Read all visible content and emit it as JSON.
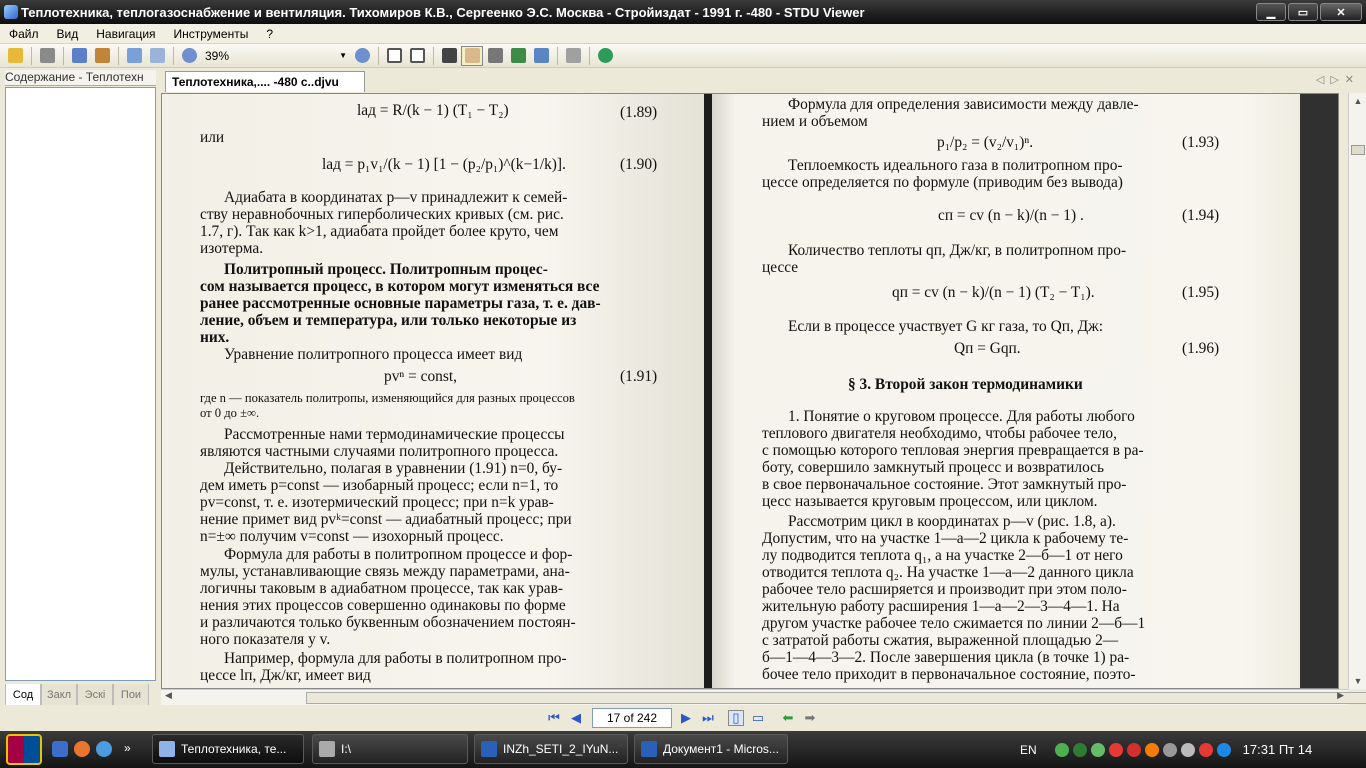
{
  "window": {
    "title": "Теплотехника, теплогазоснабжение и вентиляция. Тихомиров К.В., Сергеенко Э.С. Москва - Стройиздат - 1991 г. -480 - STDU Viewer",
    "min_label": "▁",
    "max_label": "▭",
    "close_label": "✕"
  },
  "menu": [
    "Файл",
    "Вид",
    "Навигация",
    "Инструменты",
    "?"
  ],
  "toolbar": {
    "zoom": "39%"
  },
  "left_panel": {
    "title": "Содержание - Теплотехн",
    "tabs": [
      "Сод",
      "Закл",
      "Эскі",
      "Пои"
    ]
  },
  "doc_tab": {
    "label": "Теплотехника,.... -480 с..djvu"
  },
  "page_left": {
    "eq189": "lад = R/(k − 1) (T₁ − T₂)",
    "eq189_no": "(1.89)",
    "ili": "или",
    "eq190": "lад = p₁v₁/(k − 1) [1 − (p₂/p₁)^(k−1/k)].",
    "eq190_no": "(1.90)",
    "p1": [
      "Адиабата в координатах p—v принадлежит к семей-",
      "ству неравнобочных гиперболических кривых (см. рис.",
      "1.7, г). Так как k>1, адиабата пройдет более круто, чем",
      "изотерма."
    ],
    "p2": [
      "Политропный процесс. Политропным процес-",
      "сом называется процесс, в котором могут изменяться все",
      "ранее рассмотренные основные параметры газа, т. е. дав-",
      "ление, объем и температура, или только некоторые из",
      "них."
    ],
    "p3": "Уравнение политропного процесса имеет вид",
    "eq191": "pvⁿ = const,",
    "eq191_no": "(1.91)",
    "note": [
      "где n — показатель политропы, изменяющийся для разных процессов",
      "от 0 до ±∞."
    ],
    "p4": [
      "Рассмотренные нами термодинамические процессы",
      "являются частными случаями политропного процесса."
    ],
    "p5": [
      "Действительно, полагая в уравнении (1.91) n=0, бу-",
      "дем иметь p=const — изобарный процесс; если n=1, то",
      "pv=const, т. е. изотермический процесс; при n=k урав-",
      "нение примет вид pvᵏ=const — адиабатный процесс; при",
      "n=±∞ получим v=const — изохорный процесс."
    ],
    "p6": [
      "Формула для работы в политропном процессе и фор-",
      "мулы, устанавливающие связь между параметрами, ана-",
      "логичны таковым в адиабатном процессе, так как урав-",
      "нения этих процессов совершенно одинаковы по форме",
      "и различаются только буквенным обозначением постоян-",
      "ного показателя у v."
    ],
    "p7": [
      "Например, формула для работы в политропном про-",
      "цессе lп, Дж/кг, имеет вид"
    ]
  },
  "page_right": {
    "p1": [
      "Формула для определения зависимости между давле-",
      "нием и объемом"
    ],
    "eq193": "p₁/p₂ = (v₂/v₁)ⁿ.",
    "eq193_no": "(1.93)",
    "p2": [
      "Теплоемкость идеального газа в политропном про-",
      "цессе определяется по формуле (приводим без вывода)"
    ],
    "eq194": "cп = cv (n − k)/(n − 1) .",
    "eq194_no": "(1.94)",
    "p3": [
      "Количество теплоты qп, Дж/кг, в политропном про-",
      "цессе"
    ],
    "eq195": "qп = cv (n − k)/(n − 1) (T₂ − T₁).",
    "eq195_no": "(1.95)",
    "p4": "Если в процессе участвует G кг газа, то Qп, Дж:",
    "eq196": "Qп = Gqп.",
    "eq196_no": "(1.96)",
    "heading": "§ 3. Второй закон термодинамики",
    "p5": [
      "1. Понятие о круговом процессе. Для работы любого",
      "теплового двигателя необходимо, чтобы рабочее тело,",
      "с помощью которого тепловая энергия превращается в ра-",
      "боту, совершило замкнутый процесс и возвратилось",
      "в свое первоначальное состояние. Этот замкнутый про-",
      "цесс называется круговым процессом, или циклом."
    ],
    "p6": [
      "Рассмотрим цикл в координатах p—v (рис. 1.8, а).",
      "Допустим, что на участке 1—а—2 цикла к рабочему те-",
      "лу подводится теплота q₁, а на участке 2—б—1 от него",
      "отводится теплота q₂. На участке 1—а—2 данного цикла",
      "рабочее тело расширяется и производит при этом поло-",
      "жительную работу расширения 1—а—2—3—4—1. На",
      "другом участке рабочее тело сжимается по линии 2—б—1",
      "с затратой работы сжатия, выраженной площадью 2—",
      "б—1—4—3—2. После завершения цикла (в точке 1) ра-",
      "бочее тело приходит в первоначальное состояние, поэто-"
    ]
  },
  "status": {
    "page": "17 of 242"
  },
  "taskbar": {
    "tasks": [
      "Теплотехника, те...",
      "I:\\",
      "INZh_SETI_2_IYuN...",
      "Документ1 - Micros..."
    ],
    "lang": "EN",
    "clock": "17:31 Пт 14"
  }
}
